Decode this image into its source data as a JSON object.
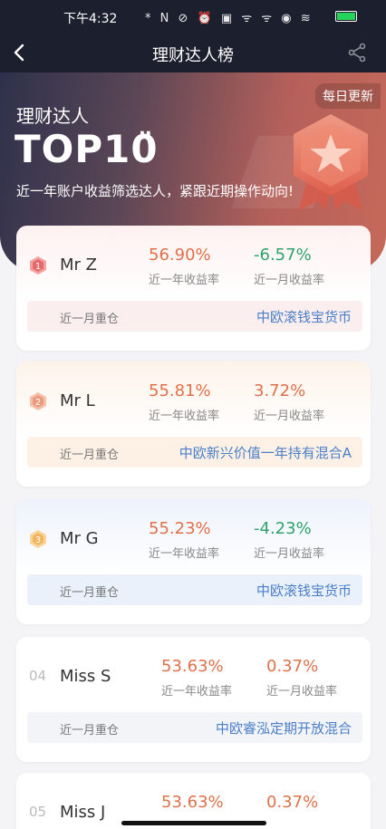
{
  "status_bar": {
    "time": "下午4:32",
    "icons": "* N ⊘ ⏰ ▣ ᯤ ᯤ ◉ ≋",
    "battery_level": 1.0
  },
  "nav": {
    "title": "理财达人榜"
  },
  "hero": {
    "daily_update": "每日更新",
    "subtitle": "理财达人",
    "top_label": "TOP10",
    "quote": "\"",
    "description": "近一年账户收益筛选达人，紧跟近期操作动向!",
    "medal_icon": "star-medal-icon"
  },
  "cards": [
    {
      "rank": "1",
      "name": "Mr Z",
      "year_return": "56.90%",
      "year_label": "近一年收益率",
      "month_return": "-6.57%",
      "month_label": "近一月收益率",
      "month_sign": "neg",
      "holding_label": "近一月重仓",
      "holding_fund": "中欧滚钱宝货币",
      "badge_color": "#e66a6a"
    },
    {
      "rank": "2",
      "name": "Mr L",
      "year_return": "55.81%",
      "year_label": "近一年收益率",
      "month_return": "3.72%",
      "month_label": "近一月收益率",
      "month_sign": "pos",
      "holding_label": "近一月重仓",
      "holding_fund": "中欧新兴价值一年持有混合A",
      "badge_color": "#ec9a7d"
    },
    {
      "rank": "3",
      "name": "Mr G",
      "year_return": "55.23%",
      "year_label": "近一年收益率",
      "month_return": "-4.23%",
      "month_label": "近一月收益率",
      "month_sign": "neg",
      "holding_label": "近一月重仓",
      "holding_fund": "中欧滚钱宝货币",
      "badge_color": "#f2b45c"
    },
    {
      "rank": "04",
      "name": "Miss S",
      "year_return": "53.63%",
      "year_label": "近一年收益率",
      "month_return": "0.37%",
      "month_label": "近一月收益率",
      "month_sign": "pos",
      "holding_label": "近一月重仓",
      "holding_fund": "中欧睿泓定期开放混合"
    },
    {
      "rank": "05",
      "name": "Miss J",
      "year_return": "53.63%",
      "month_return": "0.37%",
      "month_sign": "pos"
    }
  ]
}
